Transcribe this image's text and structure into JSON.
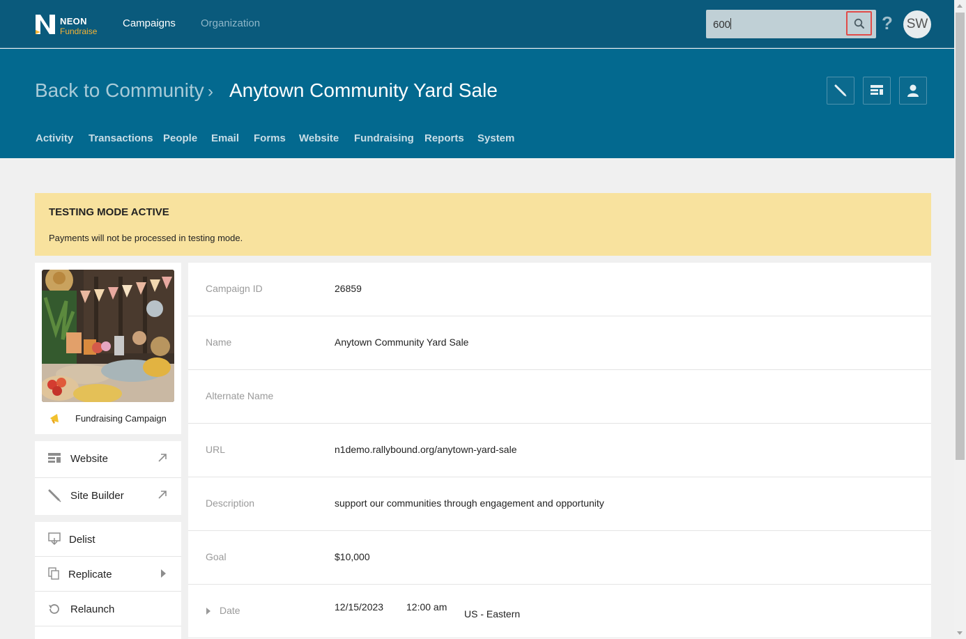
{
  "brand": {
    "line1": "NEON",
    "line2": "Fundraise",
    "accent": "#f5b335"
  },
  "topnav": {
    "campaigns": "Campaigns",
    "organization": "Organization"
  },
  "search": {
    "value": "600",
    "icon": "search-icon"
  },
  "help": "?",
  "user": {
    "initials": "SW"
  },
  "breadcrumb": {
    "back": "Back to Community",
    "separator": "›",
    "current": "Anytown Community Yard Sale"
  },
  "header_actions": [
    "site-builder-icon",
    "website-icon",
    "person-icon"
  ],
  "subnav": [
    "Activity",
    "Transactions",
    "People",
    "Email",
    "Forms",
    "Website",
    "Fundraising",
    "Reports",
    "System"
  ],
  "banner": {
    "title": "TESTING MODE ACTIVE",
    "body": "Payments will not be processed in testing mode.",
    "color": "#f8e29e"
  },
  "campaign_card": {
    "type_label": "Fundraising Campaign"
  },
  "quick_links": [
    {
      "label": "Website"
    },
    {
      "label": "Site Builder"
    }
  ],
  "actions": [
    {
      "label": "Delist"
    },
    {
      "label": "Replicate"
    },
    {
      "label": "Relaunch"
    }
  ],
  "details": {
    "campaign_id": {
      "label": "Campaign ID",
      "value": "26859"
    },
    "name": {
      "label": "Name",
      "value": "Anytown Community Yard Sale"
    },
    "alternate_name": {
      "label": "Alternate Name",
      "value": ""
    },
    "url": {
      "label": "URL",
      "value": "n1demo.rallybound.org/anytown-yard-sale"
    },
    "description": {
      "label": "Description",
      "value": "support our communities through engagement and opportunity"
    },
    "goal": {
      "label": "Goal",
      "value": "$10,000"
    },
    "date": {
      "label": "Date",
      "date": "12/15/2023",
      "time": "12:00 am",
      "timezone": "US - Eastern"
    }
  },
  "colors": {
    "topbar": "#0a5a7c",
    "header": "#03698f",
    "highlight": "#e14b48"
  }
}
